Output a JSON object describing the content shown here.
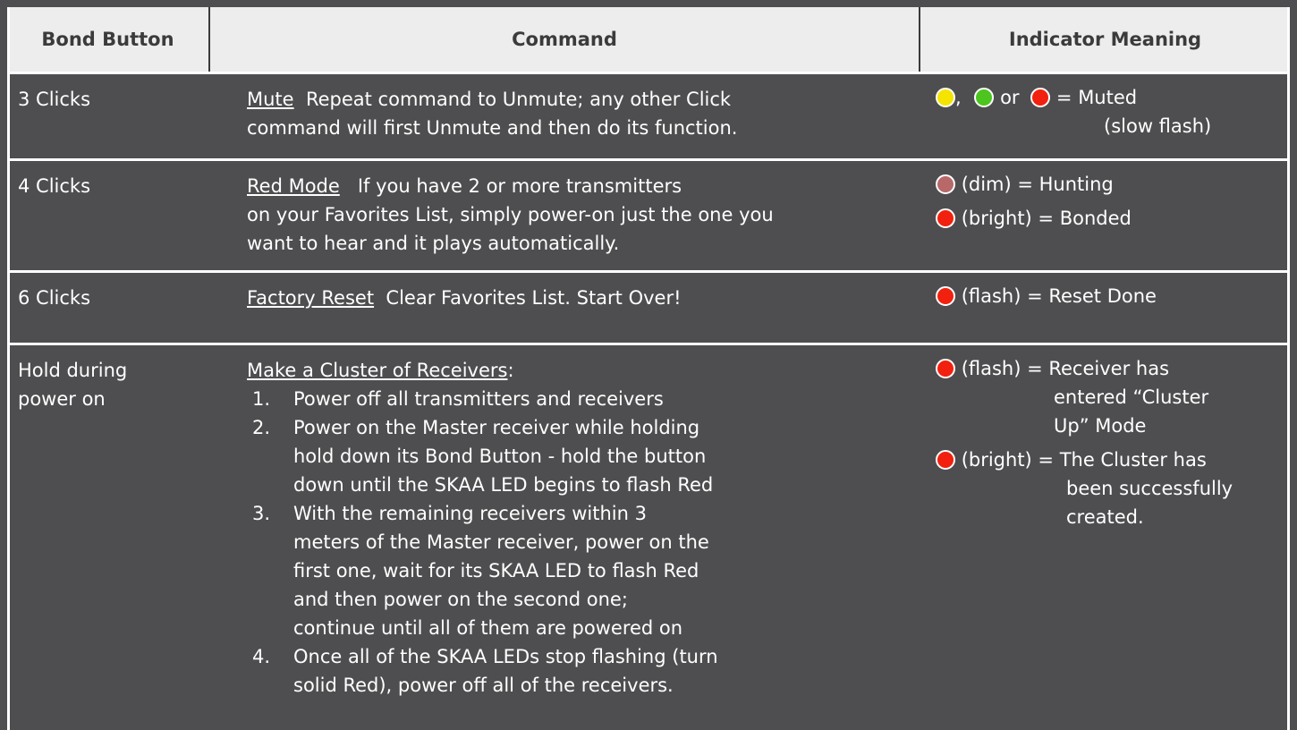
{
  "header": {
    "col1": "Bond Button",
    "col2": "Command",
    "col3": "Indicator Meaning"
  },
  "colors": {
    "yellow": "#f4e400",
    "green": "#4cc51e",
    "red": "#f2200e",
    "dim_red": "#b86868"
  },
  "rows": [
    {
      "button": "3 Clicks",
      "cmd_title": "Mute",
      "cmd_text_1": "Repeat command to Unmute; any other Click",
      "cmd_text_2": "command will first Unmute and then do its function.",
      "ind_sep": ",",
      "ind_or": "or",
      "ind_text": "= Muted",
      "ind_text_2": "(slow flash)"
    },
    {
      "button": "4 Clicks",
      "cmd_title": "Red Mode",
      "cmd_text_1": "If you have 2 or more transmitters",
      "cmd_text_2": "on your Favorites List, simply power-on just the one you",
      "cmd_text_3": "want to hear and it plays automatically.",
      "ind_1": "(dim) = Hunting",
      "ind_2": "(bright) = Bonded"
    },
    {
      "button": "6 Clicks",
      "cmd_title": "Factory Reset",
      "cmd_text_1": "Clear Favorites List.  Start Over!",
      "ind_1": "(flash) = Reset Done"
    },
    {
      "button_1": "Hold during",
      "button_2": "power on",
      "cmd_title": "Make a Cluster of Receivers",
      "cmd_colon": ":",
      "steps": [
        {
          "num": "1.",
          "lines": [
            "Power off all transmitters and receivers"
          ]
        },
        {
          "num": "2.",
          "lines": [
            "Power on the Master receiver while holding",
            "hold down its Bond Button - hold the button",
            "down until the SKAA LED begins to flash Red"
          ]
        },
        {
          "num": "3.",
          "lines": [
            "With the remaining receivers within 3",
            "meters of the Master receiver, power on the",
            "first one, wait for its SKAA LED to flash Red",
            "and then power on the second one;",
            "continue until all of them are powered on"
          ]
        },
        {
          "num": "4.",
          "lines": [
            "Once all of the SKAA LEDs stop flashing (turn",
            "solid Red), power off all of the receivers."
          ]
        }
      ],
      "ind_1a": "(flash) = Receiver has",
      "ind_1b": "entered “Cluster",
      "ind_1c": "Up” Mode",
      "ind_2a": "(bright) = The Cluster has",
      "ind_2b": "been successfully",
      "ind_2c": "created."
    }
  ]
}
